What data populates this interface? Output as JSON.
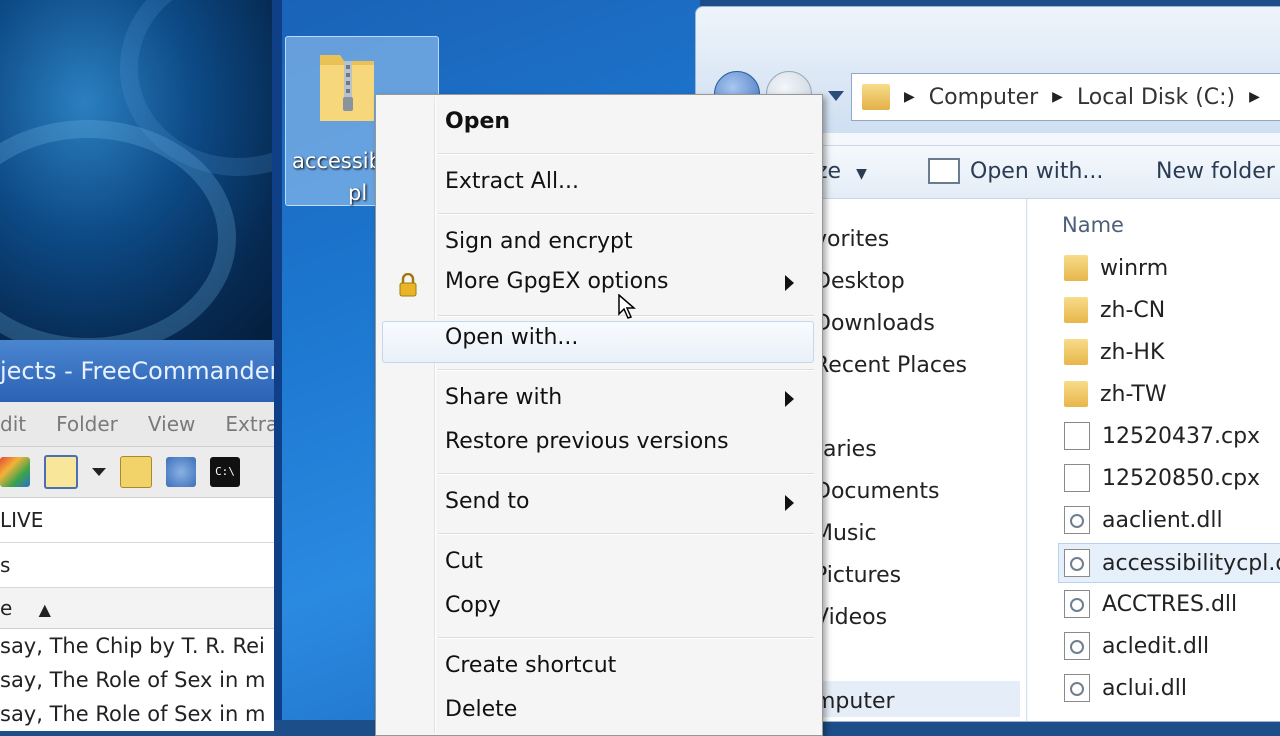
{
  "desktop": {
    "icon_label_line1": "accessib",
    "icon_label_line2": "pl"
  },
  "freecommander": {
    "title": "jects - FreeCommander",
    "menu": [
      "dit",
      "Folder",
      "View",
      "Extras"
    ],
    "drive_row": "LIVE",
    "path_row": "s",
    "column_header": "e",
    "files": [
      "say, The Chip by T. R. Rei",
      "say, The Role of Sex in m",
      "say, The Role of Sex in m"
    ]
  },
  "explorer": {
    "breadcrumb": [
      "Computer",
      "Local Disk (C:)"
    ],
    "cmdbar": {
      "organize_partial": "ze",
      "open_with": "Open with...",
      "new_folder": "New folder"
    },
    "nav_items": [
      "vorites",
      "Desktop",
      "Downloads",
      "Recent Places",
      "raries",
      "Documents",
      "Music",
      "Pictures",
      "Videos",
      "mputer"
    ],
    "column_name": "Name",
    "files": [
      {
        "name": "winrm",
        "type": "folder"
      },
      {
        "name": "zh-CN",
        "type": "folder"
      },
      {
        "name": "zh-HK",
        "type": "folder"
      },
      {
        "name": "zh-TW",
        "type": "folder"
      },
      {
        "name": "12520437.cpx",
        "type": "file"
      },
      {
        "name": "12520850.cpx",
        "type": "file"
      },
      {
        "name": "aaclient.dll",
        "type": "dll"
      },
      {
        "name": "accessibilitycpl.dl",
        "type": "dll",
        "selected": true
      },
      {
        "name": "ACCTRES.dll",
        "type": "dll"
      },
      {
        "name": "acledit.dll",
        "type": "dll"
      },
      {
        "name": "aclui.dll",
        "type": "dll"
      }
    ]
  },
  "context_menu": {
    "open": "Open",
    "extract_all": "Extract All...",
    "sign_encrypt": "Sign and encrypt",
    "more_gpgex": "More GpgEX options",
    "open_with": "Open with...",
    "share_with": "Share with",
    "restore_previous": "Restore previous versions",
    "send_to": "Send to",
    "cut": "Cut",
    "copy": "Copy",
    "create_shortcut": "Create shortcut",
    "delete": "Delete"
  }
}
